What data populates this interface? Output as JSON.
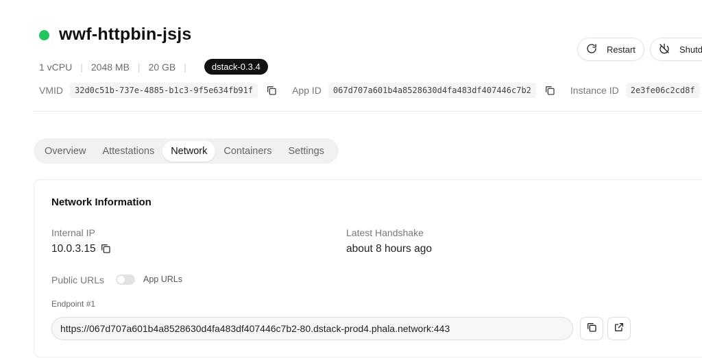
{
  "header": {
    "title": "wwf-httpbin-jsjs",
    "status_color": "#22c55e",
    "actions": {
      "restart_label": "Restart",
      "shutdown_label": "Shutd"
    }
  },
  "specs": {
    "vcpu": "1 vCPU",
    "memory": "2048 MB",
    "disk": "20 GB",
    "version": "dstack-0.3.4"
  },
  "ids": {
    "vmid_label": "VMID",
    "vmid_value": "32d0c51b-737e-4885-b1c3-9f5e634fb91f",
    "app_id_label": "App ID",
    "app_id_value": "067d707a601b4a8528630d4fa483df407446c7b2",
    "instance_id_label": "Instance ID",
    "instance_id_value": "2e3fe06c2cd8f"
  },
  "tabs": [
    {
      "label": "Overview"
    },
    {
      "label": "Attestations"
    },
    {
      "label": "Network",
      "active": true
    },
    {
      "label": "Containers"
    },
    {
      "label": "Settings"
    }
  ],
  "network": {
    "title": "Network Information",
    "internal_ip_label": "Internal IP",
    "internal_ip_value": "10.0.3.15",
    "handshake_label": "Latest Handshake",
    "handshake_value": "about 8 hours ago",
    "public_urls_label": "Public URLs",
    "toggle_label": "App URLs",
    "endpoint_label": "Endpoint #1",
    "endpoint_url": "https://067d707a601b4a8528630d4fa483df407446c7b2-80.dstack-prod4.phala.network:443"
  },
  "icons": [
    "restart-icon",
    "power-icon",
    "copy-icon",
    "external-link-icon"
  ]
}
